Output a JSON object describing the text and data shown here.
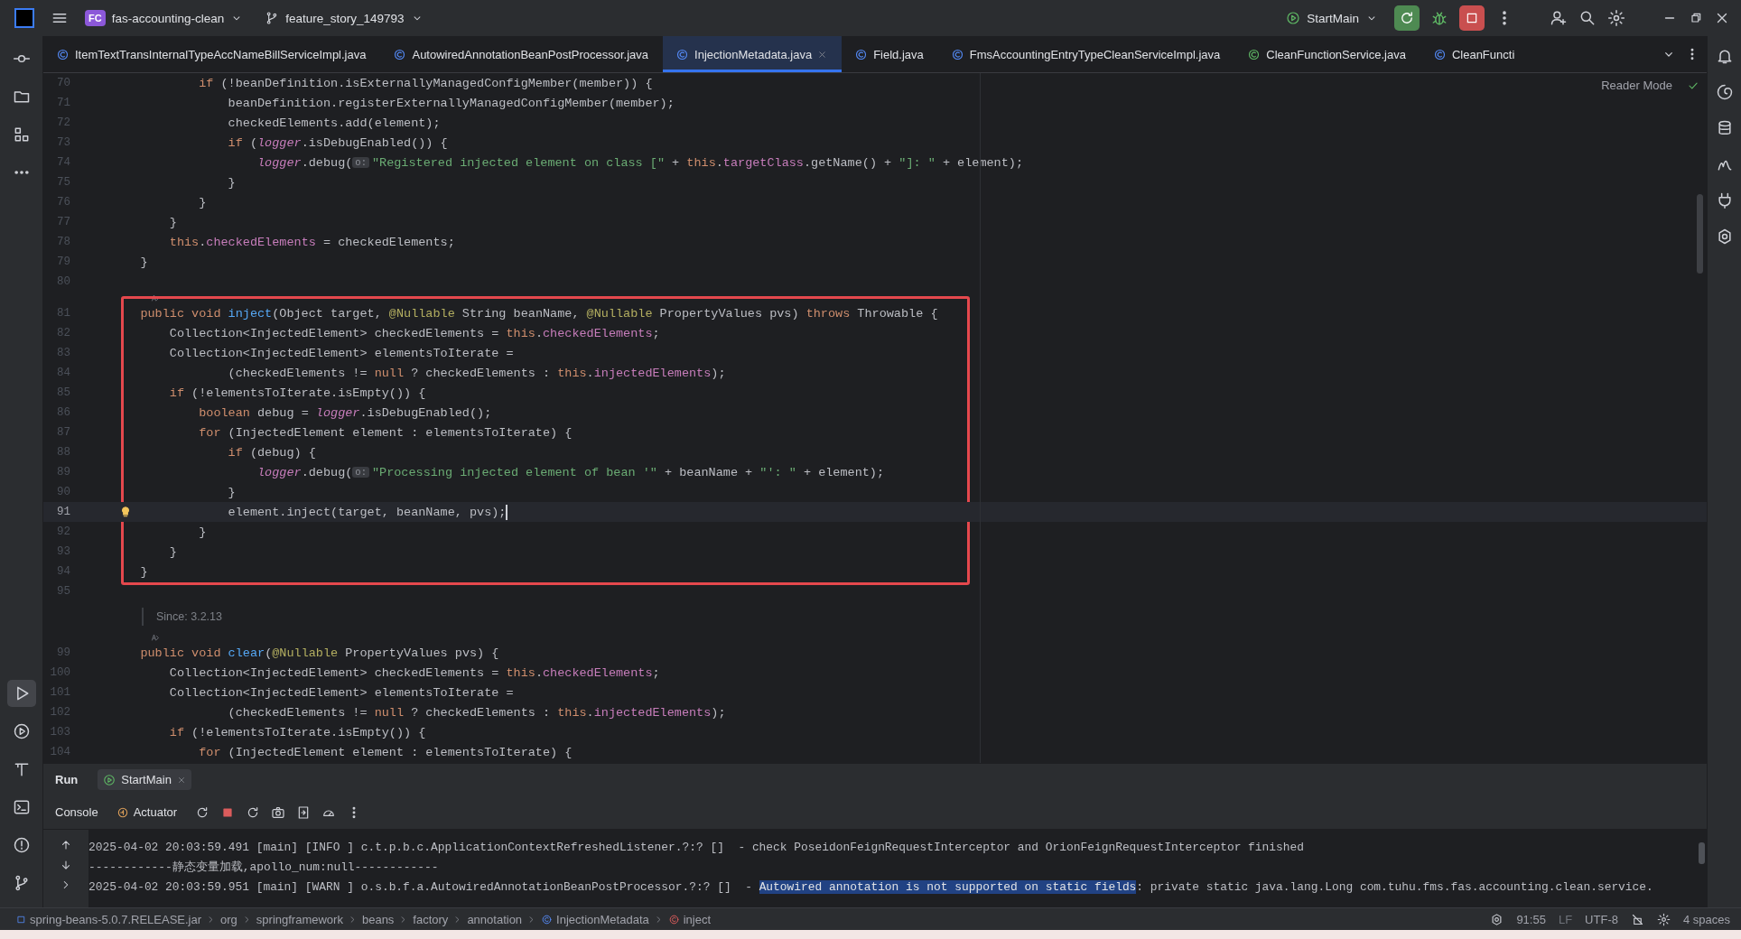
{
  "title_bar": {
    "project_badge": "FC",
    "project": "fas-accounting-clean",
    "branch": "feature_story_149793",
    "run_config": "StartMain"
  },
  "left_toolbar": {
    "top": [
      {
        "kind": "commit",
        "selected": false
      },
      {
        "kind": "project",
        "selected": false
      },
      {
        "kind": "structure",
        "selected": false
      },
      {
        "kind": "more",
        "selected": false
      }
    ],
    "bottom": [
      {
        "kind": "run",
        "selected": true
      },
      {
        "kind": "services",
        "selected": false
      },
      {
        "kind": "build",
        "selected": false
      },
      {
        "kind": "terminal",
        "selected": false
      },
      {
        "kind": "problems",
        "selected": false
      },
      {
        "kind": "git",
        "selected": false
      }
    ]
  },
  "right_toolbar": [
    {
      "kind": "notifications"
    },
    {
      "kind": "assistant"
    },
    {
      "kind": "database"
    },
    {
      "kind": "maven"
    },
    {
      "kind": "plugin"
    },
    {
      "kind": "ai"
    }
  ],
  "editor_tabs": [
    {
      "label": "ItemTextTransInternalTypeAccNameBillServiceImpl.java",
      "kind": "class",
      "selected": false
    },
    {
      "label": "AutowiredAnnotationBeanPostProcessor.java",
      "kind": "class",
      "selected": false
    },
    {
      "label": "InjectionMetadata.java",
      "kind": "class",
      "selected": true
    },
    {
      "label": "Field.java",
      "kind": "class",
      "selected": false
    },
    {
      "label": "FmsAccountingEntryTypeCleanServiceImpl.java",
      "kind": "class",
      "selected": false
    },
    {
      "label": "CleanFunctionService.java",
      "kind": "interface",
      "selected": false
    },
    {
      "label": "CleanFuncti",
      "kind": "class",
      "selected": false
    }
  ],
  "editor": {
    "reader_mode": "Reader Mode",
    "rows": [
      {
        "kind": "code",
        "number": "70",
        "tokens": [
          {
            "kind": "kw",
            "text": "            if"
          },
          {
            "kind": "p",
            "text": " (!beanDefinition.isExternallyManagedConfigMember(member)) {"
          }
        ]
      },
      {
        "kind": "code",
        "number": "71",
        "tokens": [
          {
            "kind": "p",
            "text": "                beanDefinition.registerExternallyManagedConfigMember(member);"
          }
        ]
      },
      {
        "kind": "code",
        "number": "72",
        "tokens": [
          {
            "kind": "p",
            "text": "                checkedElements.add(element);"
          }
        ]
      },
      {
        "kind": "code",
        "number": "73",
        "tokens": [
          {
            "kind": "kw",
            "text": "                if"
          },
          {
            "kind": "p",
            "text": " ("
          },
          {
            "kind": "log",
            "text": "logger"
          },
          {
            "kind": "p",
            "text": ".isDebugEnabled()) {"
          }
        ]
      },
      {
        "kind": "code",
        "number": "74",
        "tokens": [
          {
            "kind": "log",
            "text": "                    logger"
          },
          {
            "kind": "p",
            "text": ".debug("
          },
          {
            "kind": "hint",
            "text": "o:"
          },
          {
            "kind": "str",
            "text": "\"Registered injected element on class [\""
          },
          {
            "kind": "p",
            "text": " + "
          },
          {
            "kind": "kw",
            "text": "this"
          },
          {
            "kind": "p",
            "text": "."
          },
          {
            "kind": "fld",
            "text": "targetClass"
          },
          {
            "kind": "p",
            "text": ".getName() + "
          },
          {
            "kind": "str",
            "text": "\"]: \""
          },
          {
            "kind": "p",
            "text": " + element);"
          }
        ]
      },
      {
        "kind": "code",
        "number": "75",
        "tokens": [
          {
            "kind": "p",
            "text": "                }"
          }
        ]
      },
      {
        "kind": "code",
        "number": "76",
        "tokens": [
          {
            "kind": "p",
            "text": "            }"
          }
        ]
      },
      {
        "kind": "code",
        "number": "77",
        "tokens": [
          {
            "kind": "p",
            "text": "        }"
          }
        ]
      },
      {
        "kind": "code",
        "number": "78",
        "tokens": [
          {
            "kind": "kw",
            "text": "        this"
          },
          {
            "kind": "p",
            "text": "."
          },
          {
            "kind": "fld",
            "text": "checkedElements"
          },
          {
            "kind": "p",
            "text": " = checkedElements;"
          }
        ]
      },
      {
        "kind": "code",
        "number": "79",
        "tokens": [
          {
            "kind": "p",
            "text": "    }"
          }
        ]
      },
      {
        "kind": "code",
        "number": "80",
        "tokens": []
      },
      {
        "kind": "inlay"
      },
      {
        "kind": "box",
        "rows": [
          {
            "kind": "code",
            "number": "81",
            "tokens": [
              {
                "kind": "kw",
                "text": "    public void "
              },
              {
                "kind": "fn",
                "text": "inject"
              },
              {
                "kind": "p",
                "text": "(Object target, "
              },
              {
                "kind": "ann",
                "text": "@Nullable"
              },
              {
                "kind": "p",
                "text": " String beanName, "
              },
              {
                "kind": "ann",
                "text": "@Nullable"
              },
              {
                "kind": "p",
                "text": " PropertyValues pvs) "
              },
              {
                "kind": "kw",
                "text": "throws"
              },
              {
                "kind": "p",
                "text": " Throwable {"
              }
            ]
          },
          {
            "kind": "code",
            "number": "82",
            "tokens": [
              {
                "kind": "p",
                "text": "        Collection<InjectedElement> checkedElements = "
              },
              {
                "kind": "kw",
                "text": "this"
              },
              {
                "kind": "p",
                "text": "."
              },
              {
                "kind": "fld",
                "text": "checkedElements"
              },
              {
                "kind": "p",
                "text": ";"
              }
            ]
          },
          {
            "kind": "code",
            "number": "83",
            "tokens": [
              {
                "kind": "p",
                "text": "        Collection<InjectedElement> elementsToIterate ="
              }
            ]
          },
          {
            "kind": "code",
            "number": "84",
            "tokens": [
              {
                "kind": "p",
                "text": "                (checkedElements != "
              },
              {
                "kind": "kw",
                "text": "null"
              },
              {
                "kind": "p",
                "text": " ? checkedElements : "
              },
              {
                "kind": "kw",
                "text": "this"
              },
              {
                "kind": "p",
                "text": "."
              },
              {
                "kind": "fld",
                "text": "injectedElements"
              },
              {
                "kind": "p",
                "text": ");"
              }
            ]
          },
          {
            "kind": "code",
            "number": "85",
            "tokens": [
              {
                "kind": "kw",
                "text": "        if"
              },
              {
                "kind": "p",
                "text": " (!elementsToIterate.isEmpty()) {"
              }
            ]
          },
          {
            "kind": "code",
            "number": "86",
            "tokens": [
              {
                "kind": "kw",
                "text": "            boolean"
              },
              {
                "kind": "p",
                "text": " debug = "
              },
              {
                "kind": "log",
                "text": "logger"
              },
              {
                "kind": "p",
                "text": ".isDebugEnabled();"
              }
            ]
          },
          {
            "kind": "code",
            "number": "87",
            "tokens": [
              {
                "kind": "kw",
                "text": "            for"
              },
              {
                "kind": "p",
                "text": " (InjectedElement element : elementsToIterate) {"
              }
            ]
          },
          {
            "kind": "code",
            "number": "88",
            "tokens": [
              {
                "kind": "kw",
                "text": "                if"
              },
              {
                "kind": "p",
                "text": " (debug) {"
              }
            ]
          },
          {
            "kind": "code",
            "number": "89",
            "tokens": [
              {
                "kind": "log",
                "text": "                    logger"
              },
              {
                "kind": "p",
                "text": ".debug("
              },
              {
                "kind": "hint",
                "text": "o:"
              },
              {
                "kind": "str",
                "text": "\"Processing injected element of bean '\""
              },
              {
                "kind": "p",
                "text": " + beanName + "
              },
              {
                "kind": "str",
                "text": "\"': \""
              },
              {
                "kind": "p",
                "text": " + element);"
              }
            ]
          },
          {
            "kind": "code",
            "number": "90",
            "tokens": [
              {
                "kind": "p",
                "text": "                }"
              }
            ]
          },
          {
            "kind": "code",
            "number": "91",
            "current": true,
            "tokens": [
              {
                "kind": "p",
                "text": "                element.inject(target, beanName, pvs);"
              }
            ]
          },
          {
            "kind": "code",
            "number": "92",
            "tokens": [
              {
                "kind": "p",
                "text": "            }"
              }
            ]
          },
          {
            "kind": "code",
            "number": "93",
            "tokens": [
              {
                "kind": "p",
                "text": "        }"
              }
            ]
          },
          {
            "kind": "code",
            "number": "94",
            "tokens": [
              {
                "kind": "p",
                "text": "    }"
              }
            ]
          }
        ]
      },
      {
        "kind": "code",
        "number": "95",
        "tokens": []
      },
      {
        "kind": "doc",
        "text": "Since: 3.2.13"
      },
      {
        "kind": "inlay"
      },
      {
        "kind": "code",
        "number": "99",
        "tokens": [
          {
            "kind": "kw",
            "text": "    public void "
          },
          {
            "kind": "fn",
            "text": "clear"
          },
          {
            "kind": "p",
            "text": "("
          },
          {
            "kind": "ann",
            "text": "@Nullable"
          },
          {
            "kind": "p",
            "text": " PropertyValues pvs) {"
          }
        ]
      },
      {
        "kind": "code",
        "number": "100",
        "tokens": [
          {
            "kind": "p",
            "text": "        Collection<InjectedElement> checkedElements = "
          },
          {
            "kind": "kw",
            "text": "this"
          },
          {
            "kind": "p",
            "text": "."
          },
          {
            "kind": "fld",
            "text": "checkedElements"
          },
          {
            "kind": "p",
            "text": ";"
          }
        ]
      },
      {
        "kind": "code",
        "number": "101",
        "tokens": [
          {
            "kind": "p",
            "text": "        Collection<InjectedElement> elementsToIterate ="
          }
        ]
      },
      {
        "kind": "code",
        "number": "102",
        "tokens": [
          {
            "kind": "p",
            "text": "                (checkedElements != "
          },
          {
            "kind": "kw",
            "text": "null"
          },
          {
            "kind": "p",
            "text": " ? checkedElements : "
          },
          {
            "kind": "kw",
            "text": "this"
          },
          {
            "kind": "p",
            "text": "."
          },
          {
            "kind": "fld",
            "text": "injectedElements"
          },
          {
            "kind": "p",
            "text": ");"
          }
        ]
      },
      {
        "kind": "code",
        "number": "103",
        "tokens": [
          {
            "kind": "kw",
            "text": "        if"
          },
          {
            "kind": "p",
            "text": " (!elementsToIterate.isEmpty()) {"
          }
        ]
      },
      {
        "kind": "code",
        "number": "104",
        "tokens": [
          {
            "kind": "kw",
            "text": "            for"
          },
          {
            "kind": "p",
            "text": " (InjectedElement element : elementsToIterate) {"
          }
        ]
      }
    ]
  },
  "run_panel": {
    "title": "Run",
    "tabs": [
      {
        "label": "StartMain",
        "selected": true
      }
    ],
    "views": [
      {
        "label": "Console",
        "kind": "console"
      },
      {
        "label": "Actuator",
        "kind": "actuator"
      }
    ],
    "console_lines": [
      {
        "segments": [
          {
            "text": "2025-04-02 20:03:59.491 [main] [INFO ] c.t.p.b.c.ApplicationContextRefreshedListener.?:? []  - check PoseidonFeignRequestInterceptor and OrionFeignRequestInterceptor finished",
            "highlighted": false
          }
        ]
      },
      {
        "segments": [
          {
            "text": "------------静态变量加载,apollo_num:null------------",
            "highlighted": false
          }
        ]
      },
      {
        "segments": [
          {
            "text": "2025-04-02 20:03:59.951 [main] [WARN ] o.s.b.f.a.AutowiredAnnotationBeanPostProcessor.?:? []  - ",
            "highlighted": false
          },
          {
            "text": "Autowired annotation is not supported on static fields",
            "highlighted": true
          },
          {
            "text": ": private static java.lang.Long com.tuhu.fms.fas.accounting.clean.service.",
            "highlighted": false
          }
        ]
      }
    ]
  },
  "status_bar": {
    "breadcrumbs": [
      {
        "label": "spring-beans-5.0.7.RELEASE.jar",
        "kind": "jar"
      },
      {
        "label": "org",
        "kind": "package"
      },
      {
        "label": "springframework",
        "kind": "package"
      },
      {
        "label": "beans",
        "kind": "package"
      },
      {
        "label": "factory",
        "kind": "package"
      },
      {
        "label": "annotation",
        "kind": "package"
      },
      {
        "label": "InjectionMetadata",
        "kind": "class"
      },
      {
        "label": "inject",
        "kind": "method"
      }
    ],
    "position": "91:55",
    "line_separator": "LF",
    "encoding": "UTF-8",
    "indent": "4 spaces"
  }
}
